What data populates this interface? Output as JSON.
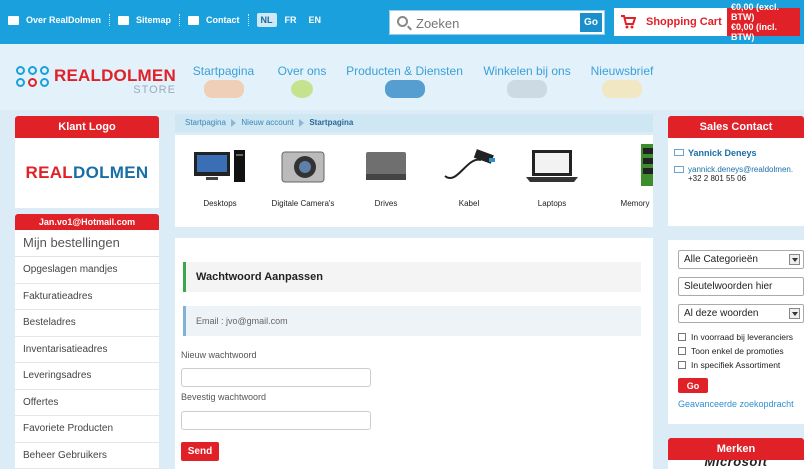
{
  "topbar": {
    "links": [
      "Over RealDolmen",
      "Sitemap",
      "Contact"
    ],
    "languages": [
      "NL",
      "FR",
      "EN"
    ],
    "active_language": "NL",
    "search_placeholder": "Zoeken",
    "search_button": "Go",
    "cart_label": "Shopping Cart :",
    "cart_excl": "€0,00 (excl. BTW)",
    "cart_incl": "€0,00 (incl. BTW)"
  },
  "header": {
    "brand": "REALDOLMEN",
    "store": "STORE",
    "nav": [
      "Startpagina",
      "Over ons",
      "Producten & Diensten",
      "Winkelen bij ons",
      "Nieuwsbrief"
    ]
  },
  "left": {
    "logo_title": "Klant Logo",
    "logo_text_real": "REAL",
    "logo_text_dolmen": "DOLMEN",
    "user": "Jan.vo1@Hotmail.com",
    "menu_title": "Mijn bestellingen",
    "menu_items": [
      "Opgeslagen mandjes",
      "Fakturatieadres",
      "Besteladres",
      "Inventarisatieadres",
      "Leveringsadres",
      "Offertes",
      "Favoriete Producten",
      "Beheer Gebruikers"
    ]
  },
  "breadcrumb": [
    "Startpagina",
    "Nieuw account",
    "Startpagina"
  ],
  "products": [
    "Desktops",
    "Digitale Camera's",
    "Drives",
    "Kabel",
    "Laptops",
    "Memory"
  ],
  "form": {
    "title": "Wachtwoord Aanpassen",
    "email": "Email : jvo@gmail.com",
    "new_password_label": "Nieuw wachtwoord",
    "confirm_password_label": "Bevestig wachtwoord",
    "send_button": "Send"
  },
  "right": {
    "contact_title": "Sales Contact",
    "contact_name": "Yannick Deneys",
    "contact_email": "yannick.deneys@realdolmen.",
    "contact_phone": "+32 2 801 55 06",
    "category_select": "Alle Categorieën",
    "keyword_input": "Sleutelwoorden hier",
    "words_select": "Al deze woorden",
    "checkboxes": [
      "In voorraad bij leveranciers",
      "Toon enkel de promoties",
      "In specifiek Assortiment"
    ],
    "go_button": "Go",
    "advanced_link": "Geavanceerde zoekopdracht",
    "brands_title": "Merken",
    "brand_logo": "Microsoft"
  },
  "colors": {
    "blue": "#1aa0dc",
    "red": "#e02128",
    "nav_text": "#3aa0d8"
  }
}
